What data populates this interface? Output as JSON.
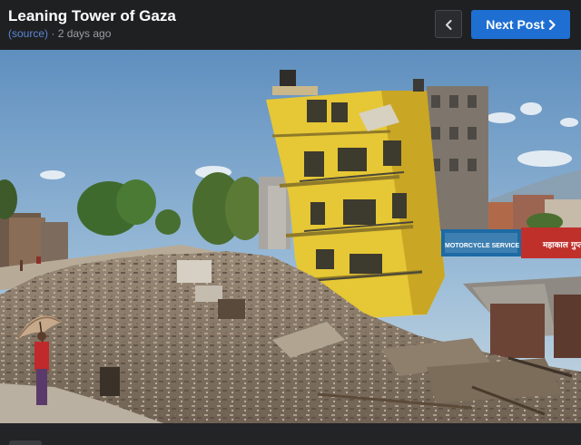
{
  "header": {
    "title": "Leaning Tower of Gaza",
    "source_label": "(source)",
    "separator": " · ",
    "time_ago": "2 days ago"
  },
  "nav": {
    "prev_icon": "chevron-left-icon",
    "next_label": "Next Post",
    "next_icon": "chevron-right-icon"
  },
  "photo": {
    "signs": {
      "sign_left": "MOTORCYCLE SERVICE",
      "sign_right": "महाकाल गुप्ता"
    }
  },
  "colors": {
    "accent": "#1f6fd3",
    "link": "#5b86d6",
    "background": "#232426"
  }
}
